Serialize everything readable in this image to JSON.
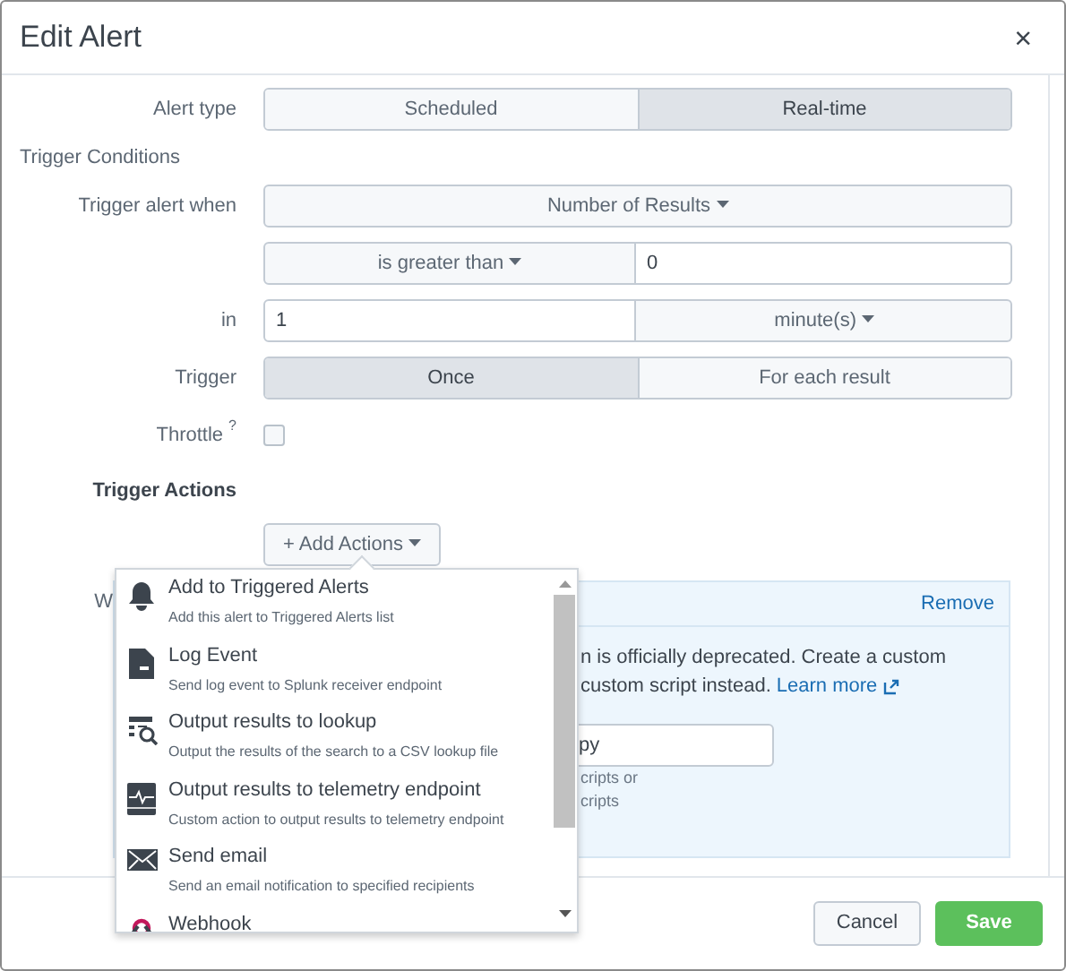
{
  "window": {
    "title": "Edit Alert",
    "close": "×"
  },
  "alert_type": {
    "label": "Alert type",
    "options": [
      {
        "label": "Scheduled",
        "selected": false
      },
      {
        "label": "Real-time",
        "selected": true
      }
    ]
  },
  "section_title": "Trigger Conditions",
  "trigger_alert_when": {
    "label": "Trigger alert when",
    "value": "Number of Results"
  },
  "condition": {
    "operator": "is greater than",
    "value": "0"
  },
  "in": {
    "label": "in",
    "value": "1",
    "unit": "minute(s)"
  },
  "trigger": {
    "label": "Trigger",
    "options": [
      {
        "label": "Once",
        "selected": true
      },
      {
        "label": "For each result",
        "selected": false
      }
    ]
  },
  "throttle": {
    "label": "Throttle",
    "help": "?",
    "checked": false
  },
  "trigger_actions": {
    "label": "Trigger Actions",
    "button": "+ Add Actions"
  },
  "action_panel": {
    "label": "W",
    "remove": "Remove",
    "lines": [
      "n is officially deprecated. Create a custom",
      "custom script instead."
    ],
    "link": "Learn more",
    "field_value": "py",
    "help_lines": [
      "cripts or",
      "cripts"
    ]
  },
  "actions_menu": [
    {
      "kind": "bell",
      "title": "Add to Triggered Alerts",
      "description": "Add this alert to Triggered Alerts list"
    },
    {
      "kind": "file",
      "title": "Log Event",
      "description": "Send log event to Splunk receiver endpoint"
    },
    {
      "kind": "lookup",
      "title": "Output results to lookup",
      "description": "Output the results of the search to a CSV lookup file"
    },
    {
      "kind": "telemetry",
      "title": "Output results to telemetry endpoint",
      "description": "Custom action to output results to telemetry endpoint"
    },
    {
      "kind": "mail",
      "title": "Send email",
      "description": "Send an email notification to specified recipients"
    },
    {
      "kind": "webhook",
      "title": "Webhook"
    }
  ],
  "footer": {
    "cancel": "Cancel",
    "save": "Save"
  }
}
